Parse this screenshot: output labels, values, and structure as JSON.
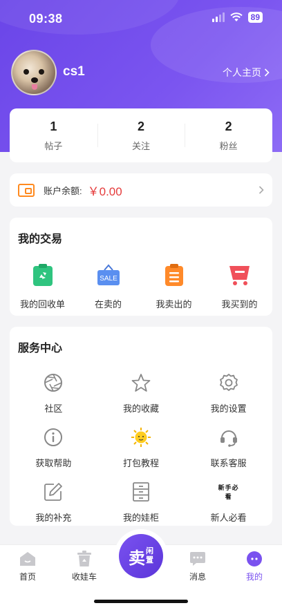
{
  "status_bar": {
    "time": "09:38",
    "battery": "89"
  },
  "profile": {
    "username": "cs1",
    "home_link": "个人主页"
  },
  "stats": [
    {
      "value": "1",
      "label": "帖子"
    },
    {
      "value": "2",
      "label": "关注"
    },
    {
      "value": "2",
      "label": "粉丝"
    }
  ],
  "balance": {
    "label": "账户余额:",
    "value": "￥0.00"
  },
  "trade": {
    "title": "我的交易",
    "items": [
      {
        "label": "我的回收单",
        "icon": "recycle-clipboard-icon",
        "color": "#2fc47f"
      },
      {
        "label": "在卖的",
        "icon": "sale-sign-icon",
        "color": "#5a8ff0",
        "badge": "SALE"
      },
      {
        "label": "我卖出的",
        "icon": "clipboard-list-icon",
        "color": "#ff8a2a"
      },
      {
        "label": "我买到的",
        "icon": "shopping-cart-icon",
        "color": "#f0505a"
      }
    ]
  },
  "service": {
    "title": "服务中心",
    "items": [
      {
        "label": "社区",
        "icon": "aperture-icon"
      },
      {
        "label": "我的收藏",
        "icon": "star-icon"
      },
      {
        "label": "我的设置",
        "icon": "gear-icon"
      },
      {
        "label": "获取帮助",
        "icon": "info-icon"
      },
      {
        "label": "打包教程",
        "icon": "sun-face-icon"
      },
      {
        "label": "联系客服",
        "icon": "headset-icon"
      },
      {
        "label": "我的补充",
        "icon": "edit-icon"
      },
      {
        "label": "我的娃柜",
        "icon": "cabinet-icon"
      },
      {
        "label": "新人必看",
        "icon": "newbie-script-icon",
        "script": "新手必看"
      }
    ]
  },
  "tabbar": {
    "items": [
      {
        "label": "首页",
        "icon": "home-icon"
      },
      {
        "label": "收娃车",
        "icon": "recycle-bin-icon"
      },
      {
        "label": "消息",
        "icon": "message-icon"
      },
      {
        "label": "我的",
        "icon": "profile-icon",
        "active": true
      }
    ],
    "sell": {
      "big": "卖",
      "small_top": "闲",
      "small_bottom": "置"
    }
  },
  "colors": {
    "primary": "#6a45e8",
    "accent": "#7a52ef",
    "price": "#e53b3b",
    "wallet": "#ff8a1f"
  }
}
